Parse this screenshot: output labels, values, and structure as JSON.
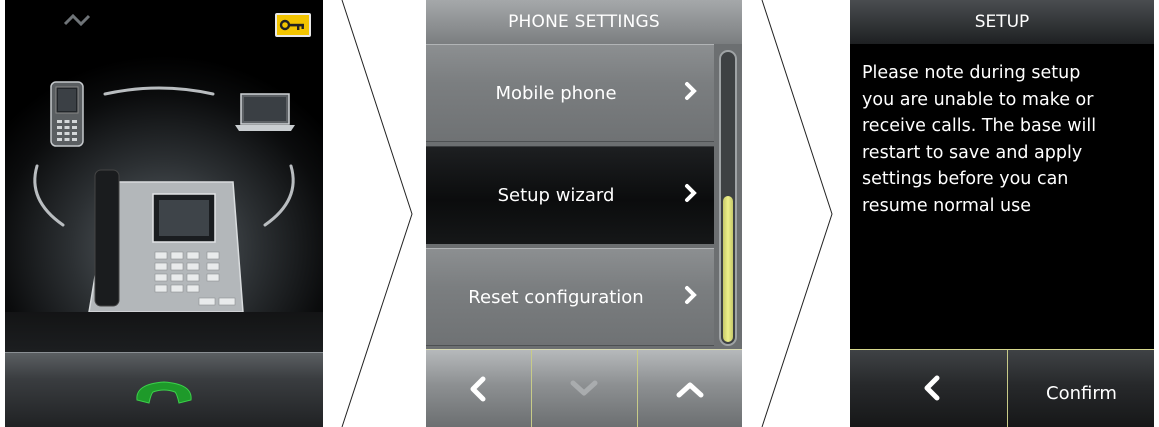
{
  "home_screen": {
    "status": {
      "signal_icon": "signal-icon",
      "settings_icon": "key-icon"
    },
    "devices": [
      "mobile-phone-icon",
      "laptop-icon",
      "desk-phone-icon"
    ],
    "bottom_bar": {
      "call_icon": "call-handset-icon",
      "call_color": "#1e9a2a"
    }
  },
  "phone_settings": {
    "title": "PHONE SETTINGS",
    "items": [
      {
        "label": "Mobile phone",
        "selected": false
      },
      {
        "label": "Setup wizard",
        "selected": true
      },
      {
        "label": "Reset configuration",
        "selected": false
      }
    ],
    "scroll_position": 1.0,
    "bottom_bar": {
      "buttons": [
        "back-arrow-icon",
        "down-arrow-icon",
        "up-arrow-icon"
      ]
    }
  },
  "setup": {
    "title": "SETUP",
    "message_lines": [
      "Please note during setup",
      "you are unable to make or",
      "receive calls. The base will",
      "restart to save and apply",
      "settings before you can",
      "resume normal use"
    ],
    "bottom_bar": {
      "back_icon": "back-arrow-icon",
      "confirm_label": "Confirm"
    }
  },
  "colors": {
    "accent_yellow": "#eef08a",
    "key_yellow": "#f2c400"
  }
}
